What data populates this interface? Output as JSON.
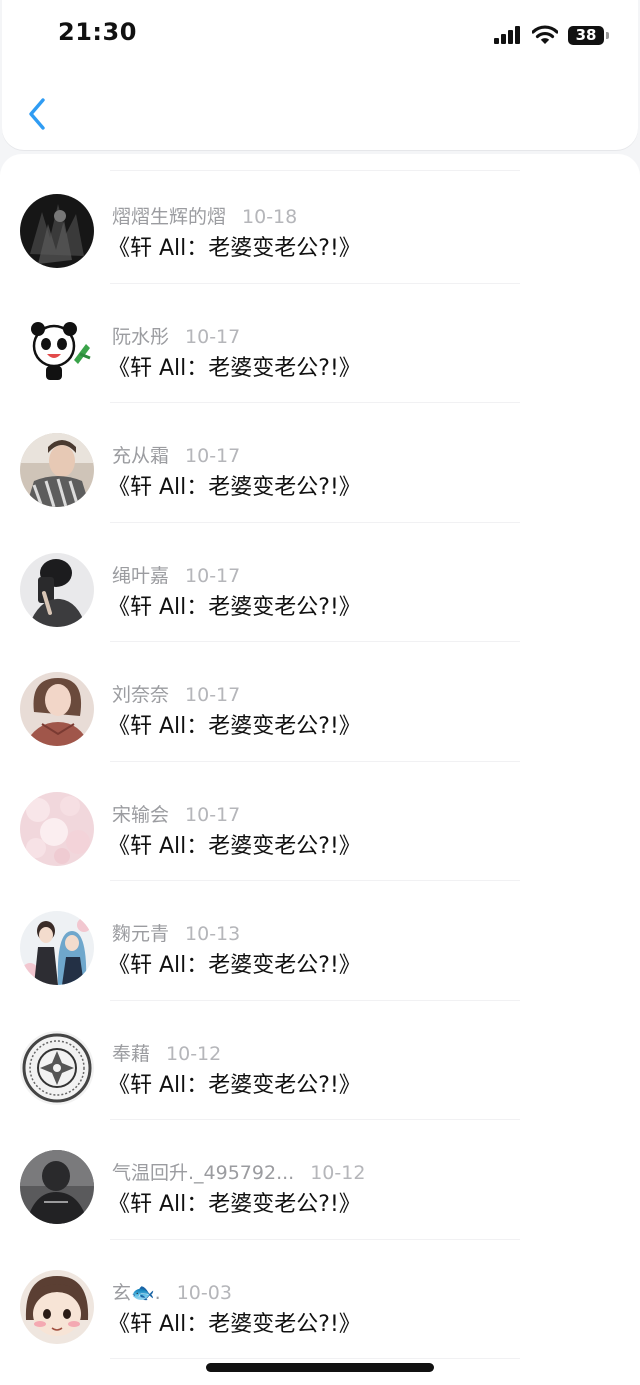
{
  "status_bar": {
    "time": "21:30",
    "battery": "38"
  },
  "nav": {
    "back_icon": "chevron-left-icon"
  },
  "items": [
    {
      "name": "熠熠生辉的熠",
      "date": "10-18",
      "title": "《轩 All：老婆变老公?!》",
      "avatar": "dark-artwork"
    },
    {
      "name": "阮水彤",
      "date": "10-17",
      "title": "《轩 All：老婆变老公?!》",
      "avatar": "panda-sticker"
    },
    {
      "name": "充从霜",
      "date": "10-17",
      "title": "《轩 All：老婆变老公?!》",
      "avatar": "person-photo"
    },
    {
      "name": "绳叶嘉",
      "date": "10-17",
      "title": "《轩 All：老婆变老公?!》",
      "avatar": "mirror-selfie"
    },
    {
      "name": "刘奈奈",
      "date": "10-17",
      "title": "《轩 All：老婆变老公?!》",
      "avatar": "woman-photo"
    },
    {
      "name": "宋输会",
      "date": "10-17",
      "title": "《轩 All：老婆变老公?!》",
      "avatar": "pink-bokeh"
    },
    {
      "name": "麴元青",
      "date": "10-13",
      "title": "《轩 All：老婆变老公?!》",
      "avatar": "anime-couple"
    },
    {
      "name": "奉藉",
      "date": "10-12",
      "title": "《轩 All：老婆变老公?!》",
      "avatar": "emblem-seal"
    },
    {
      "name": "气温回升._495792...",
      "date": "10-12",
      "title": "《轩 All：老婆变老公?!》",
      "avatar": "dark-photo"
    },
    {
      "name": "玄🐟.",
      "date": "10-03",
      "title": "《轩 All：老婆变老公?!》",
      "avatar": "cartoon-girl"
    }
  ]
}
